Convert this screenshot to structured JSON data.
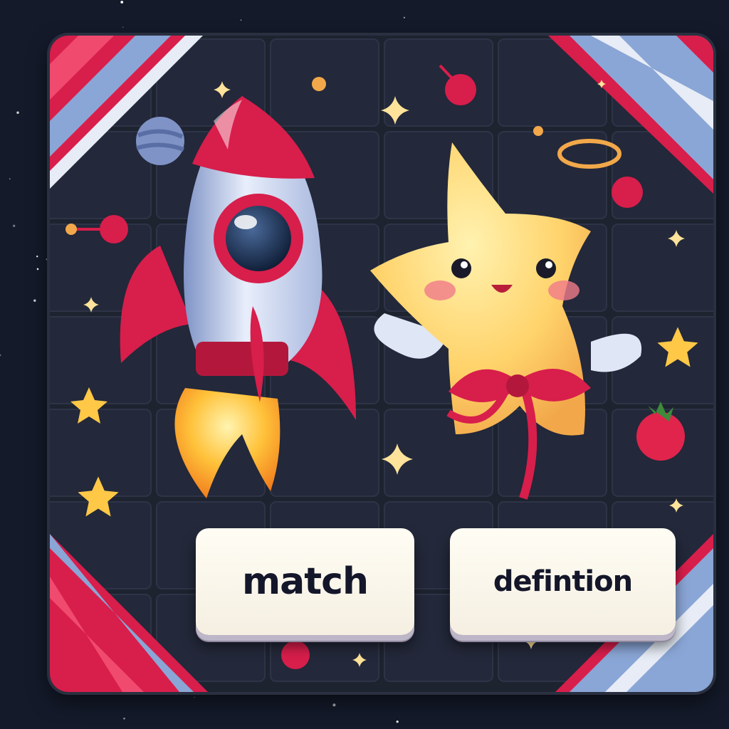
{
  "cards": [
    {
      "label": "match"
    },
    {
      "label": "defintion"
    }
  ],
  "colors": {
    "background": "#141a2a",
    "board": "#1e2330",
    "accent_red": "#d81e4b",
    "accent_blue": "#8aa6d6",
    "star_yellow": "#ffd36b",
    "card_face": "#fffdf4",
    "card_text": "#14162a"
  },
  "icons": [
    "rocket-icon",
    "star-character-icon",
    "planet-icon",
    "sparkle-icon",
    "cherry-icon",
    "halo-icon"
  ]
}
